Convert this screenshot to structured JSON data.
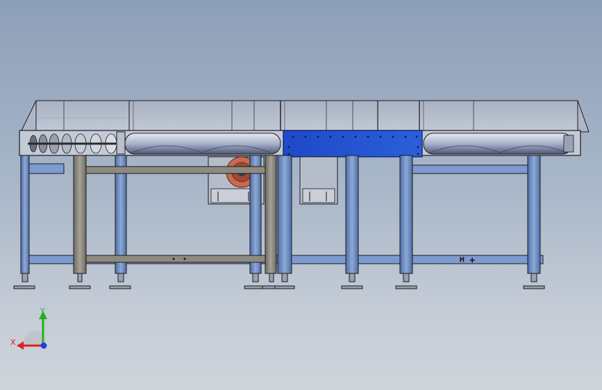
{
  "viewport": {
    "background_top": "#8d9fb8",
    "background_bottom": "#cfd4da"
  },
  "model": {
    "description_colors": {
      "frame_blue": "#6f8fc4",
      "frame_gray": "#8d8a80",
      "housing_blue": "#1f49c9",
      "hopper": "#b4bccb",
      "outline": "#1a1a1a",
      "motor": "#c86a50"
    }
  },
  "triad": {
    "x_label": "X",
    "y_label": "Y",
    "x_color": "#e02020",
    "y_color": "#20b020",
    "z_color": "#2040e0"
  }
}
